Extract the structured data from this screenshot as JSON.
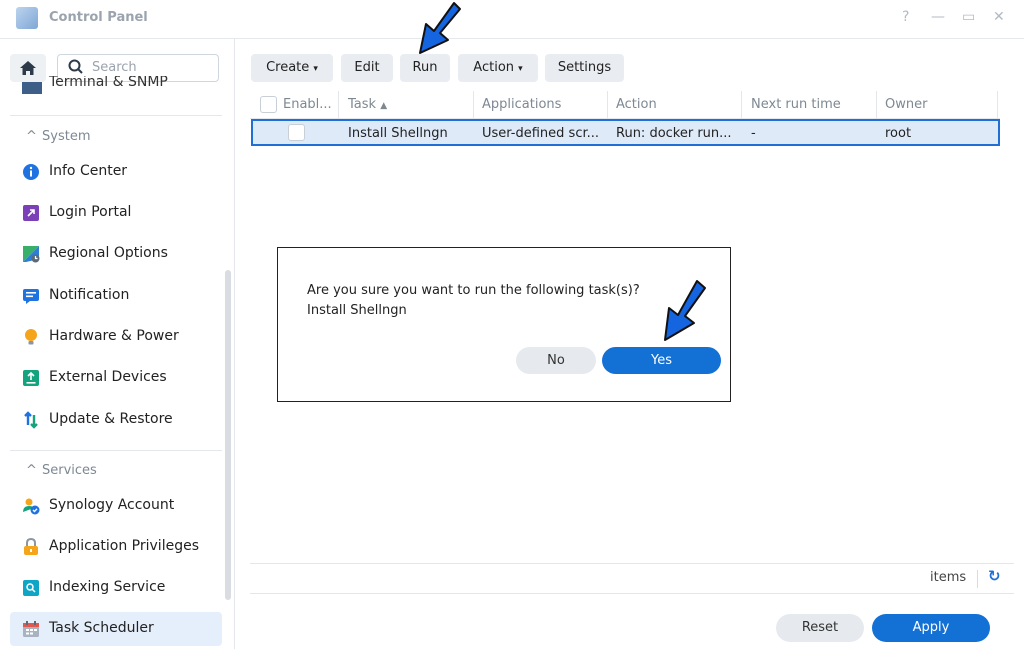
{
  "window": {
    "title": "Control Panel",
    "controls": [
      "?",
      "—",
      "▭",
      "✕"
    ]
  },
  "sidebar": {
    "search_placeholder": "Search",
    "partial_item": "Terminal & SNMP",
    "sections": [
      {
        "label": "System",
        "items": [
          {
            "label": "Info Center",
            "icon": "info-icon"
          },
          {
            "label": "Login Portal",
            "icon": "login-portal-icon"
          },
          {
            "label": "Regional Options",
            "icon": "regional-options-icon"
          },
          {
            "label": "Notification",
            "icon": "notification-icon"
          },
          {
            "label": "Hardware & Power",
            "icon": "hardware-power-icon"
          },
          {
            "label": "External Devices",
            "icon": "external-devices-icon"
          },
          {
            "label": "Update & Restore",
            "icon": "update-restore-icon"
          }
        ]
      },
      {
        "label": "Services",
        "items": [
          {
            "label": "Synology Account",
            "icon": "synology-account-icon"
          },
          {
            "label": "Application Privileges",
            "icon": "application-privileges-icon"
          },
          {
            "label": "Indexing Service",
            "icon": "indexing-service-icon"
          },
          {
            "label": "Task Scheduler",
            "icon": "task-scheduler-icon",
            "active": true
          }
        ]
      }
    ]
  },
  "toolbar": {
    "create": "Create",
    "edit": "Edit",
    "run": "Run",
    "action": "Action",
    "settings": "Settings"
  },
  "table": {
    "columns": [
      "Enabl...",
      "Task",
      "Applications",
      "Action",
      "Next run time",
      "Owner"
    ],
    "rows": [
      {
        "enabled": false,
        "task": "Install Shellngn",
        "applications": "User-defined scr...",
        "action": "Run: docker run...",
        "next_run": "-",
        "owner": "root"
      }
    ]
  },
  "footer": {
    "items_label": "items"
  },
  "buttons": {
    "reset": "Reset",
    "apply": "Apply"
  },
  "dialog": {
    "message": "Are you sure you want to run the following task(s)?",
    "task": "Install Shellngn",
    "no": "No",
    "yes": "Yes"
  },
  "colors": {
    "accent": "#1371d6",
    "selection_border": "#1f6fd6",
    "annotation_arrow": "#1565e0"
  }
}
